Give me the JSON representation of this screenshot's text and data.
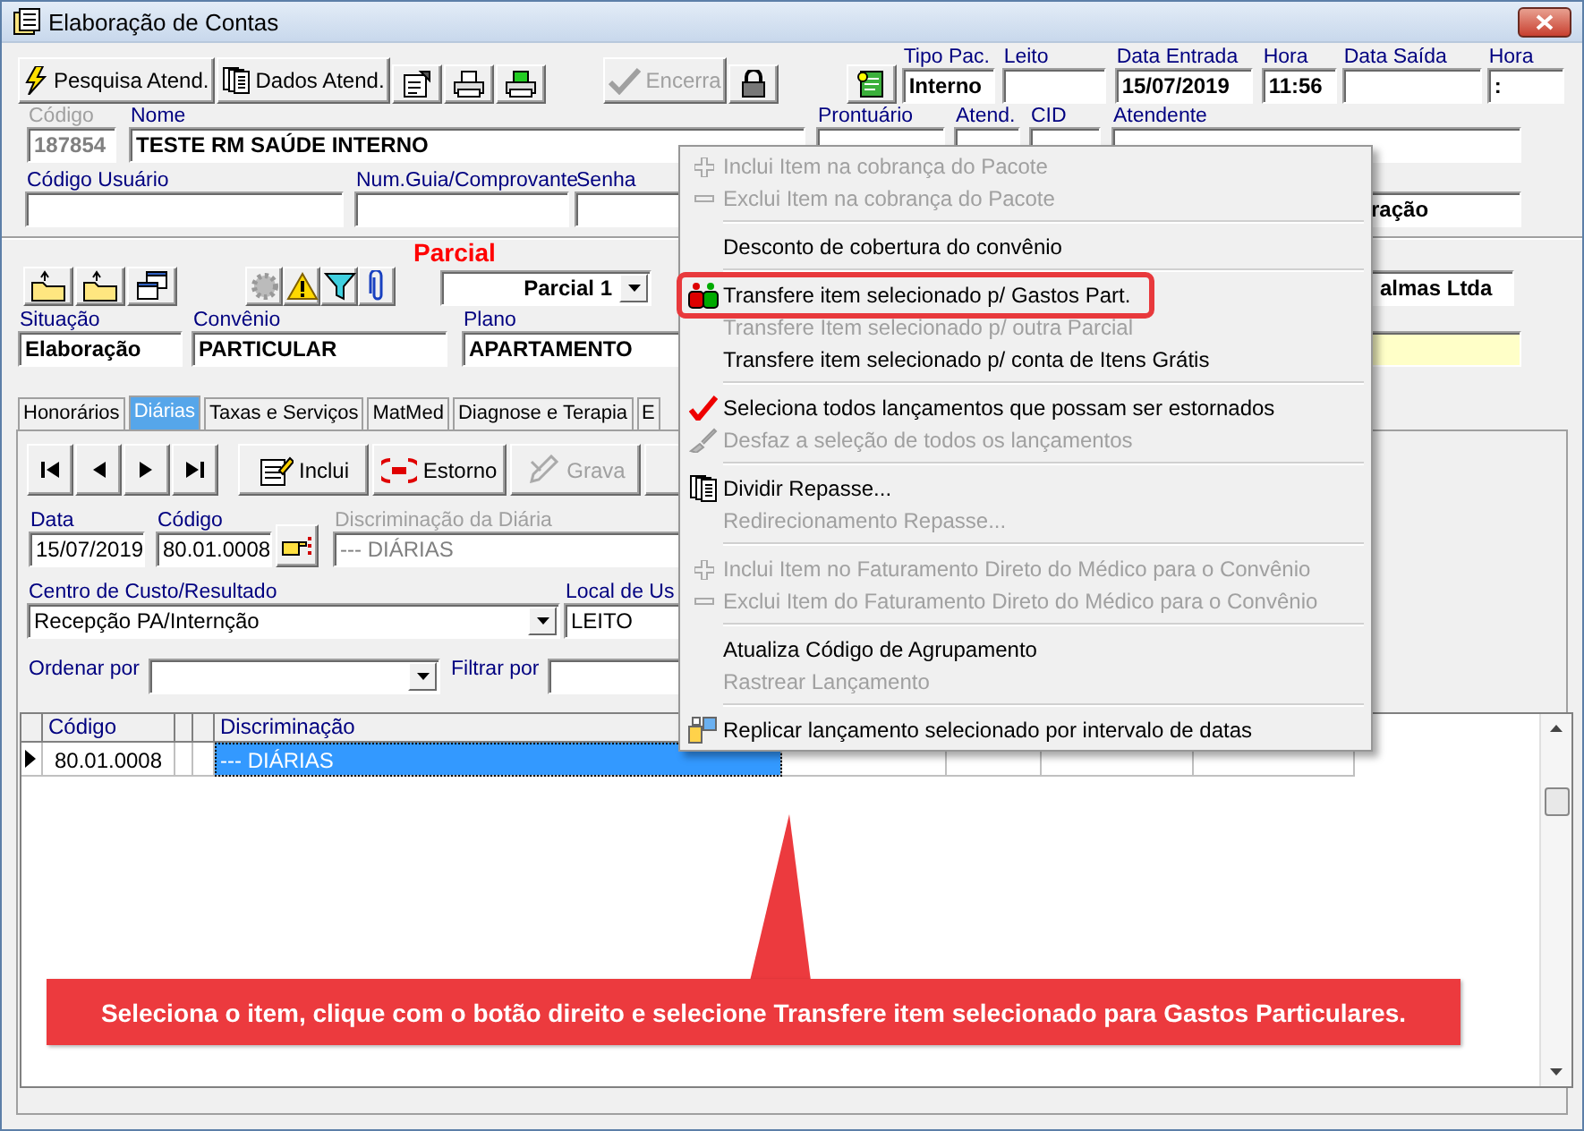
{
  "window": {
    "title": "Elaboração de Contas"
  },
  "toolbar": [
    {
      "label": "Pesquisa Atend.",
      "disabled": false
    },
    {
      "label": "Dados Atend.",
      "disabled": false
    },
    {
      "label": "Encerra",
      "disabled": true
    }
  ],
  "tipo_pac": {
    "label": "Tipo Pac.",
    "value": "Interno"
  },
  "leito": {
    "label": "Leito"
  },
  "data_entrada": {
    "label": "Data Entrada",
    "value": "15/07/2019"
  },
  "hora_entrada": {
    "label": "Hora",
    "value": "11:56"
  },
  "data_saida": {
    "label": "Data Saída"
  },
  "hora_saida": {
    "label": "Hora",
    "value": ":"
  },
  "codigo": {
    "label": "Código",
    "value": "187854",
    "disabled": true
  },
  "nome": {
    "label": "Nome",
    "value": "TESTE RM SAÚDE INTERNO",
    "disabled": false
  },
  "prontuario": {
    "label": "Prontuário"
  },
  "atend": {
    "label": "Atend."
  },
  "cid": {
    "label": "CID"
  },
  "atendente": {
    "label": "Atendente"
  },
  "codigo_usuario": {
    "label": "Código Usuário"
  },
  "num_guia": {
    "label": "Num.Guia/Comprovante"
  },
  "senha": {
    "label": "Senha"
  },
  "covered_field_1": {
    "value": "ração"
  },
  "parcial": {
    "title": "Parcial",
    "selector": "Parcial 1"
  },
  "covered_field_2": {
    "value": "almas Ltda"
  },
  "situacao": {
    "label": "Situação",
    "value": "Elaboração"
  },
  "convenio": {
    "label": "Convênio",
    "value": "PARTICULAR"
  },
  "plano": {
    "label": "Plano",
    "value": "APARTAMENTO"
  },
  "tabs": [
    {
      "label": "Honorários",
      "selected": false
    },
    {
      "label": "Diárias",
      "selected": true
    },
    {
      "label": "Taxas e Serviços",
      "selected": false
    },
    {
      "label": "MatMed",
      "selected": false
    },
    {
      "label": "Diagnose e Terapia",
      "selected": false
    },
    {
      "label": "E",
      "selected": false
    }
  ],
  "tab_toolbar": [
    {
      "label": "Inclui",
      "disabled": false
    },
    {
      "label": "Estorno",
      "disabled": false
    },
    {
      "label": "Grava",
      "disabled": true
    }
  ],
  "data": {
    "label": "Data",
    "value": "15/07/2019"
  },
  "codigo_diaria": {
    "label": "Código",
    "value": "80.01.0008"
  },
  "discriminacao": {
    "label": "Discriminação da Diária",
    "value": "--- DIÁRIAS",
    "disabled": true
  },
  "centro_custo": {
    "label": "Centro de Custo/Resultado",
    "value": "Recepção PA/Internção"
  },
  "local": {
    "label": "Local de Us",
    "value": "LEITO"
  },
  "ordenar_por": {
    "label": "Ordenar por"
  },
  "filtrar_por": {
    "label": "Filtrar por"
  },
  "grid": {
    "columns": [
      "Código",
      "Discriminação"
    ],
    "rows": [
      {
        "selected": true,
        "cells": [
          "80.01.0008",
          "--- DIÁRIAS"
        ]
      }
    ]
  },
  "context_menu": [
    {
      "kind": "item",
      "label": "Inclui Item na cobrança do Pacote",
      "disabled": true,
      "highlighted": false
    },
    {
      "kind": "item",
      "label": "Exclui Item na cobrança do Pacote",
      "disabled": true,
      "highlighted": false
    },
    {
      "kind": "separator"
    },
    {
      "kind": "item",
      "label": "Desconto de cobertura do convênio",
      "disabled": false,
      "highlighted": false
    },
    {
      "kind": "separator"
    },
    {
      "kind": "item",
      "label": "Transfere item selecionado p/ Gastos Part.",
      "disabled": false,
      "highlighted": true
    },
    {
      "kind": "item",
      "label": "Transfere Item selecionado p/ outra Parcial",
      "disabled": true,
      "highlighted": false
    },
    {
      "kind": "item",
      "label": "Transfere item selecionado p/ conta de Itens Grátis",
      "disabled": false,
      "highlighted": false
    },
    {
      "kind": "separator"
    },
    {
      "kind": "item",
      "label": "Seleciona todos lançamentos que possam ser estornados",
      "disabled": false,
      "highlighted": false
    },
    {
      "kind": "item",
      "label": "Desfaz a seleção de todos os lançamentos",
      "disabled": true,
      "highlighted": false
    },
    {
      "kind": "separator"
    },
    {
      "kind": "item",
      "label": "Dividir Repasse...",
      "disabled": false,
      "highlighted": false
    },
    {
      "kind": "item",
      "label": "Redirecionamento Repasse...",
      "disabled": true,
      "highlighted": false
    },
    {
      "kind": "separator"
    },
    {
      "kind": "item",
      "label": "Inclui Item no Faturamento Direto do Médico para o Convênio",
      "disabled": true,
      "highlighted": false
    },
    {
      "kind": "item",
      "label": "Exclui Item do Faturamento Direto do Médico para o Convênio",
      "disabled": true,
      "highlighted": false
    },
    {
      "kind": "separator"
    },
    {
      "kind": "item",
      "label": "Atualiza Código de Agrupamento",
      "disabled": false,
      "highlighted": false
    },
    {
      "kind": "item",
      "label": "Rastrear Lançamento",
      "disabled": true,
      "highlighted": false
    },
    {
      "kind": "separator"
    },
    {
      "kind": "item",
      "label": "Replicar lançamento selecionado por intervalo de datas",
      "disabled": false,
      "highlighted": false
    }
  ],
  "callout": {
    "text": "Seleciona o item, clique com o botão direito e selecione Transfere item selecionado para Gastos Particulares."
  }
}
